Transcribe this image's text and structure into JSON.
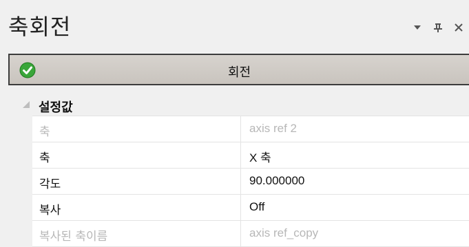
{
  "panel": {
    "title": "축회전",
    "controls": {
      "dropdown": "chevron-down-icon",
      "pin": "pin-icon",
      "close": "close-icon"
    }
  },
  "header": {
    "icon": "check-circle-icon",
    "icon_color": "#3aa63a",
    "label": "회전"
  },
  "section": {
    "label": "설정값",
    "icon": "collapse-triangle-icon"
  },
  "properties": [
    {
      "key": "축",
      "value": "axis ref 2",
      "disabled": true
    },
    {
      "key": "축",
      "value": "X 축",
      "disabled": false
    },
    {
      "key": "각도",
      "value": "90.000000",
      "disabled": false
    },
    {
      "key": "복사",
      "value": "Off",
      "disabled": false
    },
    {
      "key": "복사된 축이름",
      "value": "axis ref_copy",
      "disabled": true
    }
  ]
}
